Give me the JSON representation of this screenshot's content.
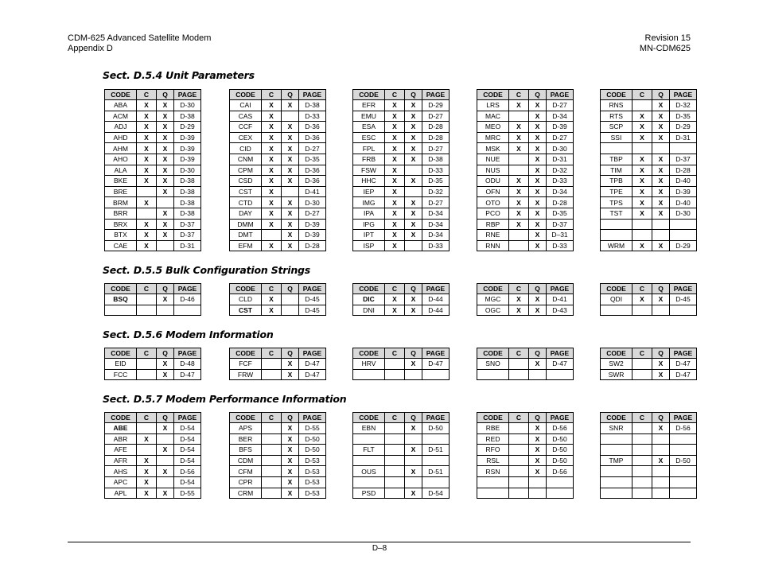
{
  "header": {
    "title": "CDM-625 Advanced Satellite Modem",
    "subtitle": "Appendix D",
    "revision": "Revision 15",
    "doc_number": "MN-CDM625"
  },
  "columns": [
    "CODE",
    "C",
    "Q",
    "PAGE"
  ],
  "sections": [
    {
      "title": "Sect. D.5.4 Unit Parameters",
      "tables": [
        [
          [
            "ABA",
            "X",
            "X",
            "D-30"
          ],
          [
            "ACM",
            "X",
            "X",
            "D-38"
          ],
          [
            "ADJ",
            "X",
            "X",
            "D-29"
          ],
          [
            "AHD",
            "X",
            "X",
            "D-39"
          ],
          [
            "AHM",
            "X",
            "X",
            "D-39"
          ],
          [
            "AHO",
            "X",
            "X",
            "D-39"
          ],
          [
            "ALA",
            "X",
            "X",
            "D-30"
          ],
          [
            "BKE",
            "X",
            "X",
            "D-38"
          ],
          [
            "BRE",
            "",
            "X",
            "D-38"
          ],
          [
            "BRM",
            "X",
            "",
            "D-38"
          ],
          [
            "BRR",
            "",
            "X",
            "D-38"
          ],
          [
            "BRX",
            "X",
            "X",
            "D-37"
          ],
          [
            "BTX",
            "X",
            "X",
            "D-37"
          ],
          [
            "CAE",
            "X",
            "",
            "D-31"
          ]
        ],
        [
          [
            "CAI",
            "X",
            "X",
            "D-38"
          ],
          [
            "CAS",
            "X",
            "",
            "D-33"
          ],
          [
            "CCF",
            "X",
            "X",
            "D-36"
          ],
          [
            "CEX",
            "X",
            "X",
            "D-36"
          ],
          [
            "CID",
            "X",
            "X",
            "D-27"
          ],
          [
            "CNM",
            "X",
            "X",
            "D-35"
          ],
          [
            "CPM",
            "X",
            "X",
            "D-36"
          ],
          [
            "CSD",
            "X",
            "X",
            "D-36"
          ],
          [
            "CST",
            "X",
            "",
            "D-41"
          ],
          [
            "CTD",
            "X",
            "X",
            "D-30"
          ],
          [
            "DAY",
            "X",
            "X",
            "D-27"
          ],
          [
            "DMM",
            "X",
            "X",
            "D-39"
          ],
          [
            "DMT",
            "",
            "X",
            "D-39"
          ],
          [
            "EFM",
            "X",
            "X",
            "D-28"
          ]
        ],
        [
          [
            "EFR",
            "X",
            "X",
            "D-29"
          ],
          [
            "EMU",
            "X",
            "X",
            "D-27"
          ],
          [
            "ESA",
            "X",
            "X",
            "D-28"
          ],
          [
            "ESC",
            "X",
            "X",
            "D-28"
          ],
          [
            "FPL",
            "X",
            "X",
            "D-27"
          ],
          [
            "FRB",
            "X",
            "X",
            "D-38"
          ],
          [
            "FSW",
            "X",
            "",
            "D-33"
          ],
          [
            "HHC",
            "X",
            "X",
            "D-35"
          ],
          [
            "IEP",
            "X",
            "",
            "D-32"
          ],
          [
            "IMG",
            "X",
            "X",
            "D-27"
          ],
          [
            "IPA",
            "X",
            "X",
            "D-34"
          ],
          [
            "IPG",
            "X",
            "X",
            "D-34"
          ],
          [
            "IPT",
            "X",
            "X",
            "D-34"
          ],
          [
            "ISP",
            "X",
            "",
            "D-33"
          ]
        ],
        [
          [
            "LRS",
            "X",
            "X",
            "D-27"
          ],
          [
            "MAC",
            "",
            "X",
            "D-34"
          ],
          [
            "MEO",
            "X",
            "X",
            "D-39"
          ],
          [
            "MRC",
            "X",
            "X",
            "D-27"
          ],
          [
            "MSK",
            "X",
            "X",
            "D-30"
          ],
          [
            "NUE",
            "",
            "X",
            "D-31"
          ],
          [
            "NUS",
            "",
            "X",
            "D-32"
          ],
          [
            "ODU",
            "X",
            "X",
            "D-33"
          ],
          [
            "OFN",
            "X",
            "X",
            "D-34"
          ],
          [
            "OTO",
            "X",
            "X",
            "D-28"
          ],
          [
            "PCO",
            "X",
            "X",
            "D-35"
          ],
          [
            "RBP",
            "X",
            "X",
            "D-37"
          ],
          [
            "RNE",
            "",
            "X",
            "D–31"
          ],
          [
            "RNN",
            "",
            "X",
            "D-33"
          ]
        ],
        [
          [
            "RNS",
            "",
            "X",
            "D-32"
          ],
          [
            "RTS",
            "X",
            "X",
            "D-35"
          ],
          [
            "SCP",
            "X",
            "X",
            "D-29"
          ],
          [
            "SSI",
            "X",
            "X",
            "D-31"
          ],
          [
            "",
            "",
            "",
            ""
          ],
          [
            "TBP",
            "X",
            "X",
            "D-37"
          ],
          [
            "TIM",
            "X",
            "X",
            "D-28"
          ],
          [
            "TPB",
            "X",
            "X",
            "D-40"
          ],
          [
            "TPE",
            "X",
            "X",
            "D-39"
          ],
          [
            "TPS",
            "X",
            "X",
            "D-40"
          ],
          [
            "TST",
            "X",
            "X",
            "D-30"
          ],
          [
            "",
            "",
            "",
            ""
          ],
          [
            "",
            "",
            "",
            ""
          ],
          [
            "WRM",
            "X",
            "X",
            "D-29"
          ]
        ]
      ]
    },
    {
      "title": "Sect. D.5.5 Bulk Configuration Strings",
      "tables": [
        [
          [
            "BSQ",
            "",
            "X",
            "D-46"
          ],
          [
            "",
            "",
            "",
            ""
          ]
        ],
        [
          [
            "CLD",
            "X",
            "",
            "D-45"
          ],
          [
            "CST",
            "X",
            "",
            "D-45"
          ]
        ],
        [
          [
            "DIC",
            "X",
            "X",
            "D-44"
          ],
          [
            "DNI",
            "X",
            "X",
            "D-44"
          ]
        ],
        [
          [
            "MGC",
            "X",
            "X",
            "D-41"
          ],
          [
            "OGC",
            "X",
            "X",
            "D-43"
          ]
        ],
        [
          [
            "QDI",
            "X",
            "X",
            "D-45"
          ],
          [
            "",
            "",
            "",
            ""
          ]
        ]
      ]
    },
    {
      "title": "Sect. D.5.6 Modem Information",
      "tables": [
        [
          [
            "EID",
            "",
            "X",
            "D-48"
          ],
          [
            "FCC",
            "",
            "X",
            "D-47"
          ]
        ],
        [
          [
            "FCF",
            "",
            "X",
            "D-47"
          ],
          [
            "FRW",
            "",
            "X",
            "D-47"
          ]
        ],
        [
          [
            "HRV",
            "",
            "X",
            "D-47"
          ],
          [
            "",
            "",
            "",
            ""
          ]
        ],
        [
          [
            "SNO",
            "",
            "X",
            "D-47"
          ],
          [
            "",
            "",
            "",
            ""
          ]
        ],
        [
          [
            "SW2",
            "",
            "X",
            "D-47"
          ],
          [
            "SWR",
            "",
            "X",
            "D-47"
          ]
        ]
      ]
    },
    {
      "title": "Sect. D.5.7 Modem Performance Information",
      "tables": [
        [
          [
            "ABE",
            "",
            "X",
            "D-54"
          ],
          [
            "ABR",
            "X",
            "",
            "D-54"
          ],
          [
            "AFE",
            "",
            "X",
            "D-54"
          ],
          [
            "AFR",
            "X",
            "",
            "D-54"
          ],
          [
            "AHS",
            "X",
            "X",
            "D-56"
          ],
          [
            "APC",
            "X",
            "",
            "D-54"
          ],
          [
            "APL",
            "X",
            "X",
            "D-55"
          ]
        ],
        [
          [
            "APS",
            "",
            "X",
            "D-55"
          ],
          [
            "BER",
            "",
            "X",
            "D-50"
          ],
          [
            "BFS",
            "",
            "X",
            "D-50"
          ],
          [
            "CDM",
            "",
            "X",
            "D-53"
          ],
          [
            "CFM",
            "",
            "X",
            "D-53"
          ],
          [
            "CPR",
            "",
            "X",
            "D-53"
          ],
          [
            "CRM",
            "",
            "X",
            "D-53"
          ]
        ],
        [
          [
            "EBN",
            "",
            "X",
            "D-50"
          ],
          [
            "",
            "",
            "",
            ""
          ],
          [
            "FLT",
            "",
            "X",
            "D-51"
          ],
          [
            "",
            "",
            "",
            ""
          ],
          [
            "OUS",
            "",
            "X",
            "D-51"
          ],
          [
            "",
            "",
            "",
            ""
          ],
          [
            "PSD",
            "",
            "X",
            "D-54"
          ]
        ],
        [
          [
            "RBE",
            "",
            "X",
            "D-56"
          ],
          [
            "RED",
            "",
            "X",
            "D-50"
          ],
          [
            "RFO",
            "",
            "X",
            "D-50"
          ],
          [
            "RSL",
            "",
            "X",
            "D-50"
          ],
          [
            "RSN",
            "",
            "X",
            "D-56"
          ],
          [
            "",
            "",
            "",
            ""
          ],
          [
            "",
            "",
            "",
            ""
          ]
        ],
        [
          [
            "SNR",
            "",
            "X",
            "D-56"
          ],
          [
            "",
            "",
            "",
            ""
          ],
          [
            "",
            "",
            "",
            ""
          ],
          [
            "TMP",
            "",
            "X",
            "D-50"
          ],
          [
            "",
            "",
            "",
            ""
          ],
          [
            "",
            "",
            "",
            ""
          ],
          [
            "",
            "",
            "",
            ""
          ]
        ]
      ]
    }
  ],
  "bold_codes": [
    "BSQ",
    "CST@1.1",
    "DIC",
    "ABE"
  ],
  "footer": {
    "page": "D–8"
  }
}
